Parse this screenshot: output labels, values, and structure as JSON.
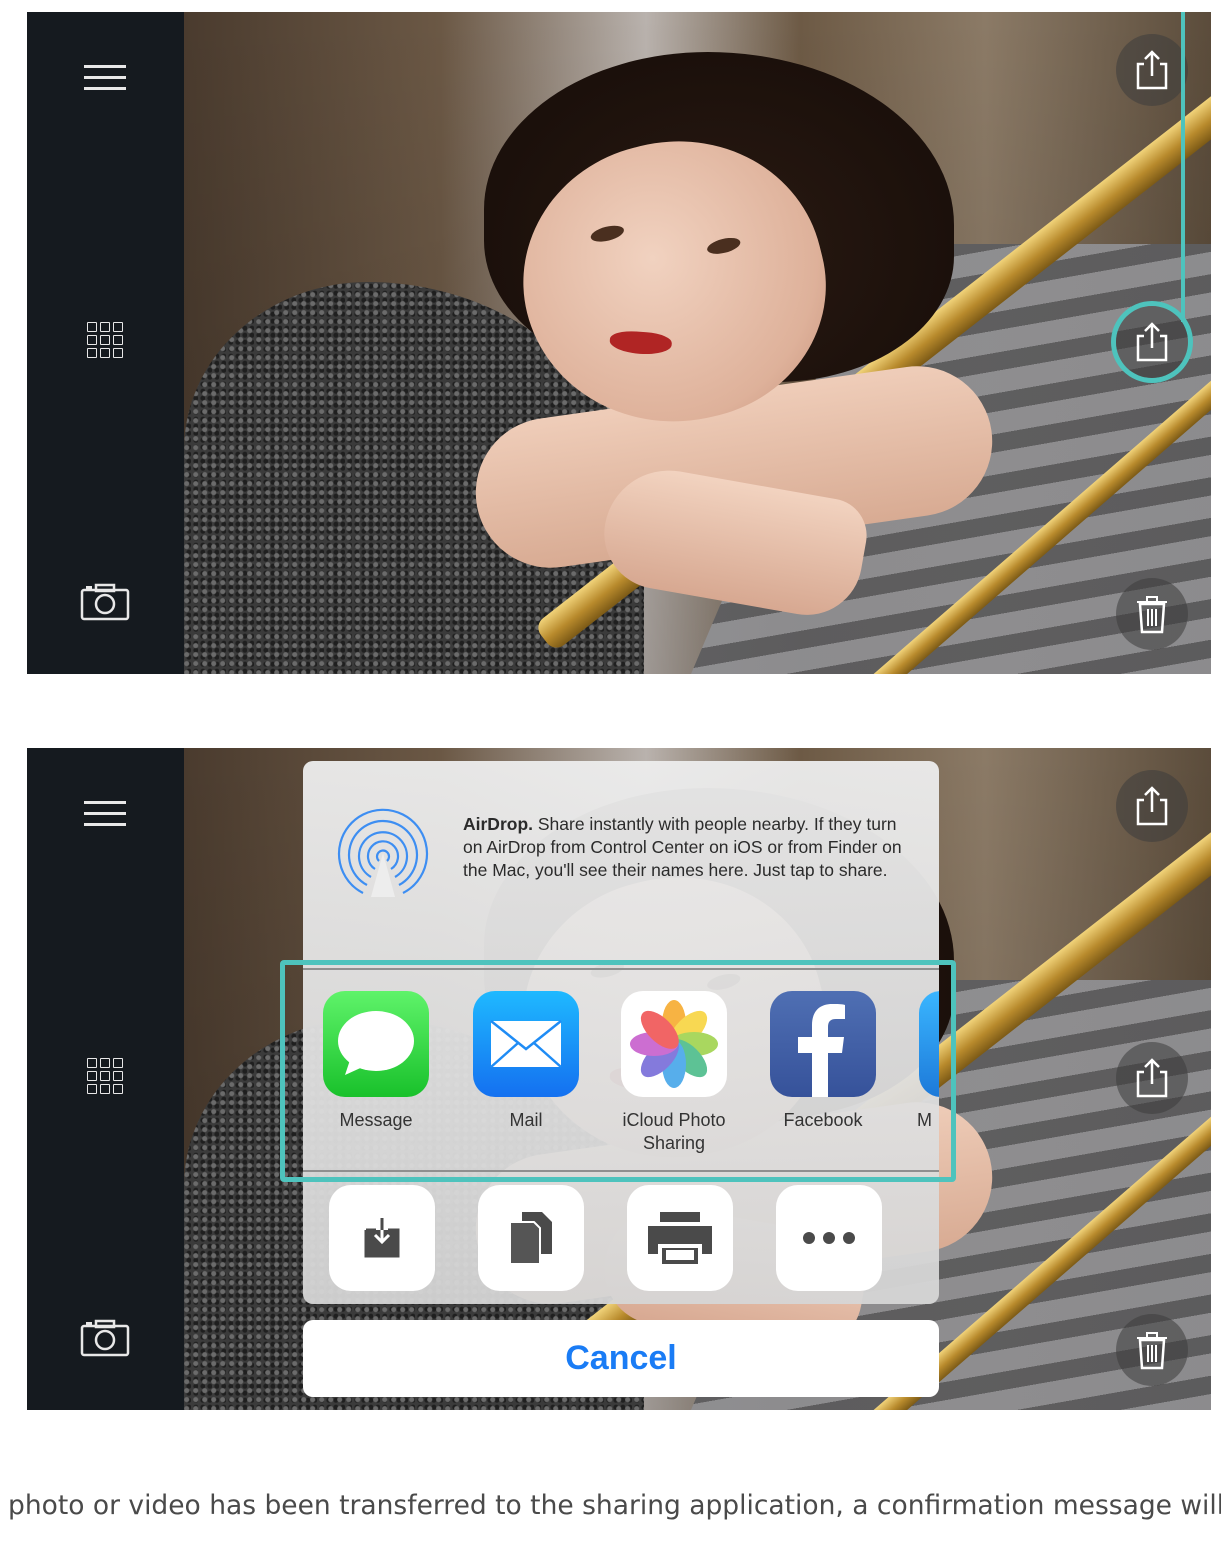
{
  "screen_top": {
    "sidebar": {
      "icons": [
        "menu-icon",
        "grid-icon",
        "camera-icon"
      ]
    },
    "right_buttons": [
      "share-icon",
      "share-icon",
      "trash-icon"
    ]
  },
  "share_sheet": {
    "airdrop_title": "AirDrop.",
    "airdrop_text": "Share instantly with people nearby. If they turn on AirDrop from Control Center on iOS or from Finder on the Mac, you'll see their names here. Just tap to share.",
    "apps": [
      {
        "label": "Message",
        "icon": "message-icon"
      },
      {
        "label": "Mail",
        "icon": "mail-icon"
      },
      {
        "label": "iCloud Photo\nSharing",
        "icon": "photos-icon"
      },
      {
        "label": "Facebook",
        "icon": "facebook-icon"
      },
      {
        "label": "M",
        "icon": "app-icon"
      }
    ],
    "actions": [
      "save-icon",
      "copy-icon",
      "print-icon",
      "more-icon"
    ],
    "cancel_label": "Cancel"
  },
  "caption": "photo or video has been transferred to the sharing application, a confirmation message will be",
  "colors": {
    "highlight": "#4ec3bd",
    "cancel": "#1a7cf5",
    "sidebar": "#151a1f"
  }
}
